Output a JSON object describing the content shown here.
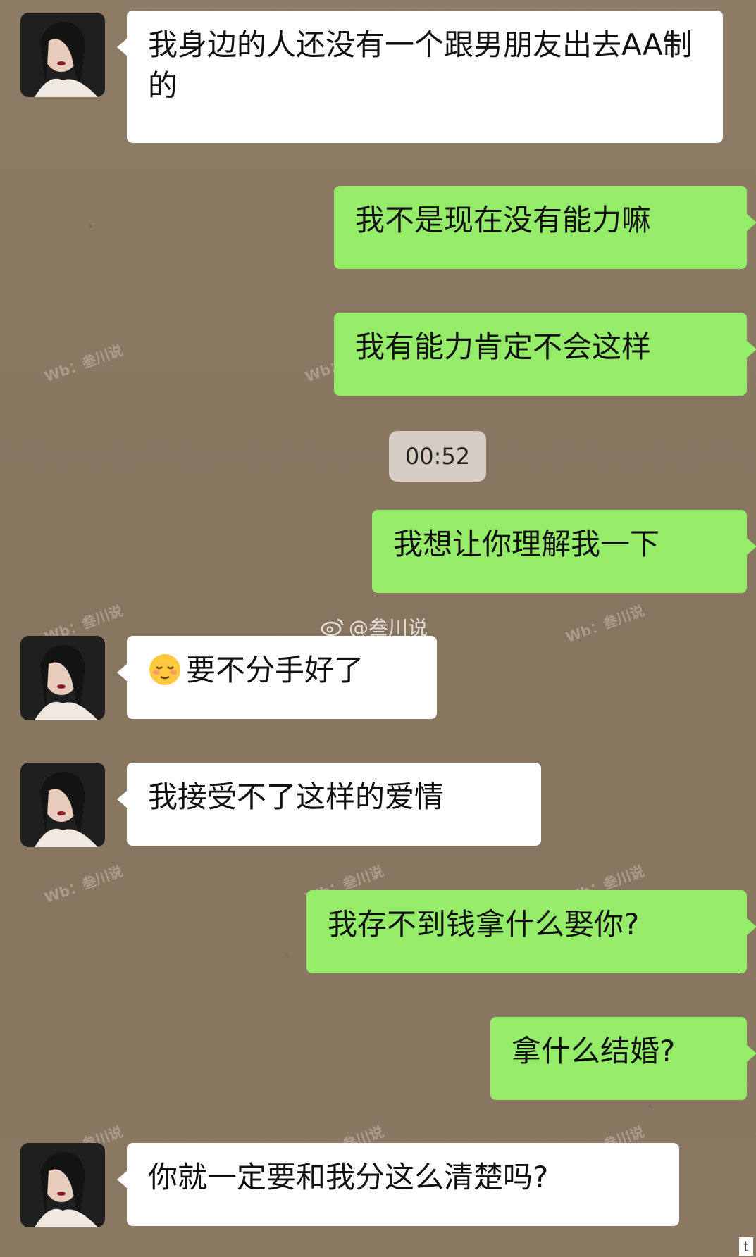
{
  "messages": [
    {
      "side": "left",
      "text": "我身边的人还没有一个跟男朋友出去AA制的"
    },
    {
      "side": "right",
      "text": "我不是现在没有能力嘛"
    },
    {
      "side": "right",
      "text": "我有能力肯定不会这样"
    },
    {
      "side": "right",
      "text": "我想让你理解我一下"
    },
    {
      "side": "left",
      "emoji": "relieved-face-icon",
      "text": "要不分手好了"
    },
    {
      "side": "left",
      "text": "我接受不了这样的爱情"
    },
    {
      "side": "right",
      "text": "我存不到钱拿什么娶你?"
    },
    {
      "side": "right",
      "text": "拿什么结婚?"
    },
    {
      "side": "left",
      "text": "你就一定要和我分这么清楚吗?"
    }
  ],
  "timestamp": "00:52",
  "watermark": {
    "handle": "@叁川说",
    "repeat_text": "Wb：叁川说"
  },
  "corner_glyph": "t",
  "colors": {
    "sent_bubble": "#95ec69",
    "received_bubble": "#ffffff",
    "background": "#8b7963"
  }
}
